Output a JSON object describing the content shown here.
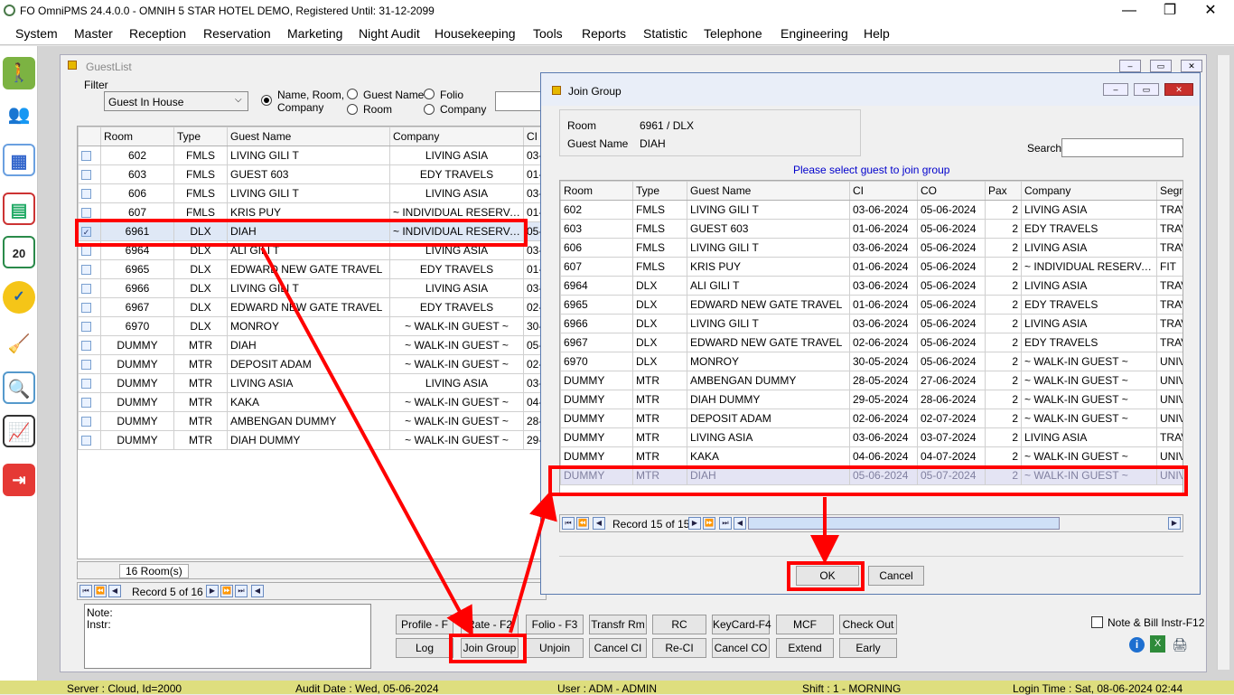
{
  "window": {
    "title": "FO OmniPMS 24.4.0.0 - OMNIH 5 STAR HOTEL DEMO, Registered Until: 31-12-2099",
    "minimize": "—",
    "restore": "❐",
    "close": "✕"
  },
  "menu": [
    "System",
    "Master",
    "Reception",
    "Reservation",
    "Marketing",
    "Night Audit",
    "Housekeeping",
    "Tools",
    "Reports",
    "Statistic",
    "Telephone",
    "Engineering",
    "Help"
  ],
  "sidebar_icons": [
    "walk-in-icon",
    "guests-icon",
    "map-icon",
    "room-grid-icon",
    "calendar-icon",
    "availability-icon",
    "housekeeping-icon",
    "search-report-icon",
    "statistics-icon",
    "exit-icon"
  ],
  "guestlist": {
    "title": "GuestList",
    "filter_label": "Filter",
    "filter_value": "Guest In House",
    "radios": {
      "name_room_company": "Name, Room,",
      "name_room_company2": "Company",
      "guest_name": "Guest Name",
      "room": "Room",
      "folio": "Folio",
      "company": "Company"
    },
    "columns": [
      "Room",
      "Type",
      "Guest Name",
      "Company",
      "CI"
    ],
    "rows": [
      {
        "room": "602",
        "type": "FMLS",
        "guest": "LIVING GILI T",
        "company": "LIVING ASIA",
        "ci": "03-"
      },
      {
        "room": "603",
        "type": "FMLS",
        "guest": "GUEST 603",
        "company": "EDY TRAVELS",
        "ci": "01-"
      },
      {
        "room": "606",
        "type": "FMLS",
        "guest": "LIVING GILI T",
        "company": "LIVING ASIA",
        "ci": "03-"
      },
      {
        "room": "607",
        "type": "FMLS",
        "guest": "KRIS PUY",
        "company": "~ INDIVIDUAL RESERVATI...",
        "ci": "01-"
      },
      {
        "room": "6961",
        "type": "DLX",
        "guest": "DIAH",
        "company": "~ INDIVIDUAL RESERVATI...",
        "ci": "05-"
      },
      {
        "room": "6964",
        "type": "DLX",
        "guest": "ALI GILI T",
        "company": "LIVING ASIA",
        "ci": "03-"
      },
      {
        "room": "6965",
        "type": "DLX",
        "guest": "EDWARD NEW GATE TRAVEL",
        "company": "EDY TRAVELS",
        "ci": "01-"
      },
      {
        "room": "6966",
        "type": "DLX",
        "guest": "LIVING GILI T",
        "company": "LIVING ASIA",
        "ci": "03-"
      },
      {
        "room": "6967",
        "type": "DLX",
        "guest": "EDWARD NEW GATE TRAVEL",
        "company": "EDY TRAVELS",
        "ci": "02-"
      },
      {
        "room": "6970",
        "type": "DLX",
        "guest": "MONROY",
        "company": "~ WALK-IN GUEST ~",
        "ci": "30-"
      },
      {
        "room": "DUMMY",
        "type": "MTR",
        "guest": "DIAH",
        "company": "~ WALK-IN GUEST ~",
        "ci": "05-"
      },
      {
        "room": "DUMMY",
        "type": "MTR",
        "guest": "DEPOSIT ADAM",
        "company": "~ WALK-IN GUEST ~",
        "ci": "02-"
      },
      {
        "room": "DUMMY",
        "type": "MTR",
        "guest": "LIVING ASIA",
        "company": "LIVING ASIA",
        "ci": "03-"
      },
      {
        "room": "DUMMY",
        "type": "MTR",
        "guest": "KAKA",
        "company": "~ WALK-IN GUEST ~",
        "ci": "04-"
      },
      {
        "room": "DUMMY",
        "type": "MTR",
        "guest": "AMBENGAN DUMMY",
        "company": "~ WALK-IN GUEST ~",
        "ci": "28-"
      },
      {
        "room": "DUMMY",
        "type": "MTR",
        "guest": "DIAH DUMMY",
        "company": "~ WALK-IN GUEST ~",
        "ci": "29-"
      }
    ],
    "room_count": "16 Room(s)",
    "record": "Record 5 of 16",
    "note_label": "Note:",
    "instr_label": "Instr:",
    "buttons_row1": [
      "Profile - F",
      "Rate - F2",
      "Folio - F3",
      "Transfr Rm",
      "RC",
      "KeyCard-F4",
      "MCF",
      "Check Out"
    ],
    "buttons_row2": [
      "Log",
      "Join Group",
      "Unjoin",
      "Cancel CI",
      "Re-CI",
      "Cancel CO",
      "Extend",
      "Early"
    ],
    "note_bill_label": "Note & Bill Instr-F12"
  },
  "joingroup": {
    "title": "Join Group",
    "room_label": "Room",
    "room_value": "6961 / DLX",
    "guest_label": "Guest Name",
    "guest_value": "DIAH",
    "search_label": "Search",
    "prompt": "Please select guest to join group",
    "columns": [
      "Room",
      "Type",
      "Guest Name",
      "CI",
      "CO",
      "Pax",
      "Company",
      "Segm"
    ],
    "rows": [
      {
        "room": "602",
        "type": "FMLS",
        "guest": "LIVING GILI T",
        "ci": "03-06-2024",
        "co": "05-06-2024",
        "pax": "2",
        "company": "LIVING ASIA",
        "seg": "TRAV"
      },
      {
        "room": "603",
        "type": "FMLS",
        "guest": "GUEST 603",
        "ci": "01-06-2024",
        "co": "05-06-2024",
        "pax": "2",
        "company": "EDY TRAVELS",
        "seg": "TRAV"
      },
      {
        "room": "606",
        "type": "FMLS",
        "guest": "LIVING GILI T",
        "ci": "03-06-2024",
        "co": "05-06-2024",
        "pax": "2",
        "company": "LIVING ASIA",
        "seg": "TRAV"
      },
      {
        "room": "607",
        "type": "FMLS",
        "guest": "KRIS PUY",
        "ci": "01-06-2024",
        "co": "05-06-2024",
        "pax": "2",
        "company": "~ INDIVIDUAL RESERVATI...",
        "seg": "FIT"
      },
      {
        "room": "6964",
        "type": "DLX",
        "guest": "ALI GILI T",
        "ci": "03-06-2024",
        "co": "05-06-2024",
        "pax": "2",
        "company": "LIVING ASIA",
        "seg": "TRAV"
      },
      {
        "room": "6965",
        "type": "DLX",
        "guest": "EDWARD NEW GATE TRAVEL",
        "ci": "01-06-2024",
        "co": "05-06-2024",
        "pax": "2",
        "company": "EDY TRAVELS",
        "seg": "TRAV"
      },
      {
        "room": "6966",
        "type": "DLX",
        "guest": "LIVING GILI T",
        "ci": "03-06-2024",
        "co": "05-06-2024",
        "pax": "2",
        "company": "LIVING ASIA",
        "seg": "TRAV"
      },
      {
        "room": "6967",
        "type": "DLX",
        "guest": "EDWARD NEW GATE TRAVEL",
        "ci": "02-06-2024",
        "co": "05-06-2024",
        "pax": "2",
        "company": "EDY TRAVELS",
        "seg": "TRAV"
      },
      {
        "room": "6970",
        "type": "DLX",
        "guest": "MONROY",
        "ci": "30-05-2024",
        "co": "05-06-2024",
        "pax": "2",
        "company": "~ WALK-IN GUEST ~",
        "seg": "UNIV"
      },
      {
        "room": "DUMMY",
        "type": "MTR",
        "guest": "AMBENGAN DUMMY",
        "ci": "28-05-2024",
        "co": "27-06-2024",
        "pax": "2",
        "company": "~ WALK-IN GUEST ~",
        "seg": "UNIV"
      },
      {
        "room": "DUMMY",
        "type": "MTR",
        "guest": "DIAH DUMMY",
        "ci": "29-05-2024",
        "co": "28-06-2024",
        "pax": "2",
        "company": "~ WALK-IN GUEST ~",
        "seg": "UNIV"
      },
      {
        "room": "DUMMY",
        "type": "MTR",
        "guest": "DEPOSIT ADAM",
        "ci": "02-06-2024",
        "co": "02-07-2024",
        "pax": "2",
        "company": "~ WALK-IN GUEST ~",
        "seg": "UNIV"
      },
      {
        "room": "DUMMY",
        "type": "MTR",
        "guest": "LIVING ASIA",
        "ci": "03-06-2024",
        "co": "03-07-2024",
        "pax": "2",
        "company": "LIVING ASIA",
        "seg": "TRAV"
      },
      {
        "room": "DUMMY",
        "type": "MTR",
        "guest": "KAKA",
        "ci": "04-06-2024",
        "co": "04-07-2024",
        "pax": "2",
        "company": "~ WALK-IN GUEST ~",
        "seg": "UNIV"
      },
      {
        "room": "DUMMY",
        "type": "MTR",
        "guest": "DIAH",
        "ci": "05-06-2024",
        "co": "05-07-2024",
        "pax": "2",
        "company": "~ WALK-IN GUEST ~",
        "seg": "UNIV"
      }
    ],
    "record": "Record 15 of 15",
    "ok": "OK",
    "cancel": "Cancel"
  },
  "status": {
    "server": "Server : Cloud, Id=2000",
    "audit": "Audit Date : Wed, 05-06-2024",
    "user": "User : ADM - ADMIN",
    "shift": "Shift : 1 - MORNING",
    "login": "Login Time : Sat, 08-06-2024 02:44"
  },
  "colors": {
    "highlight": "#ff0000",
    "link_blue": "#0000cc",
    "status_bg": "#dede7e"
  }
}
